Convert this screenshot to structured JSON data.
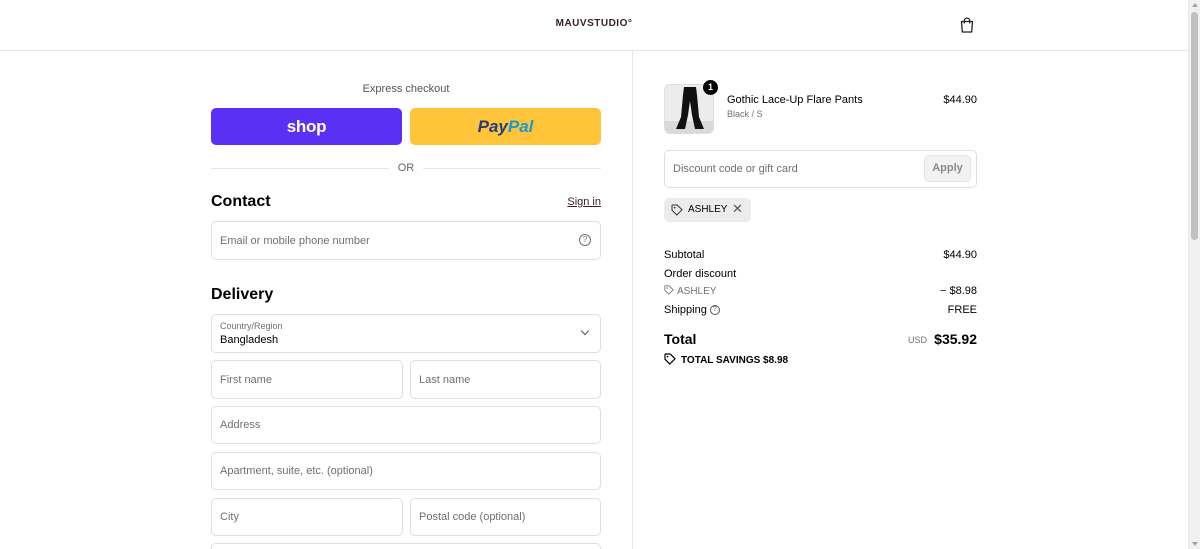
{
  "header": {
    "logo": "MAUVSTUDIO°",
    "cart_icon": "shopping-bag-icon"
  },
  "express": {
    "label": "Express checkout",
    "shop_label": "shop",
    "paypal_part1": "Pay",
    "paypal_part2": "Pal",
    "or": "OR"
  },
  "contact": {
    "title": "Contact",
    "signin": "Sign in",
    "email_placeholder": "Email or mobile phone number",
    "help_icon": "?"
  },
  "delivery": {
    "title": "Delivery",
    "country_label": "Country/Region",
    "country_value": "Bangladesh",
    "first_name": "First name",
    "last_name": "Last name",
    "address": "Address",
    "apartment": "Apartment, suite, etc. (optional)",
    "city": "City",
    "postal": "Postal code (optional)"
  },
  "order": {
    "product": {
      "name": "Gothic Lace-Up Flare Pants",
      "variant": "Black / S",
      "price": "$44.90",
      "quantity": "1"
    },
    "discount_placeholder": "Discount code or gift card",
    "apply_label": "Apply",
    "applied_code": "ASHLEY",
    "remove_symbol": "✕",
    "subtotal_label": "Subtotal",
    "subtotal_value": "$44.90",
    "order_discount_label": "Order discount",
    "discount_code": "ASHLEY",
    "discount_value": "− $8.98",
    "shipping_label": "Shipping",
    "shipping_help": "?",
    "shipping_value": "FREE",
    "total_label": "Total",
    "total_currency": "USD",
    "total_value": "$35.92",
    "savings_label": "TOTAL SAVINGS $8.98"
  },
  "colors": {
    "shop_pay": "#5a31f4",
    "paypal": "#ffc439",
    "paypal_dark": "#253b80",
    "paypal_light": "#179bd7",
    "brand": "#3a2028"
  }
}
